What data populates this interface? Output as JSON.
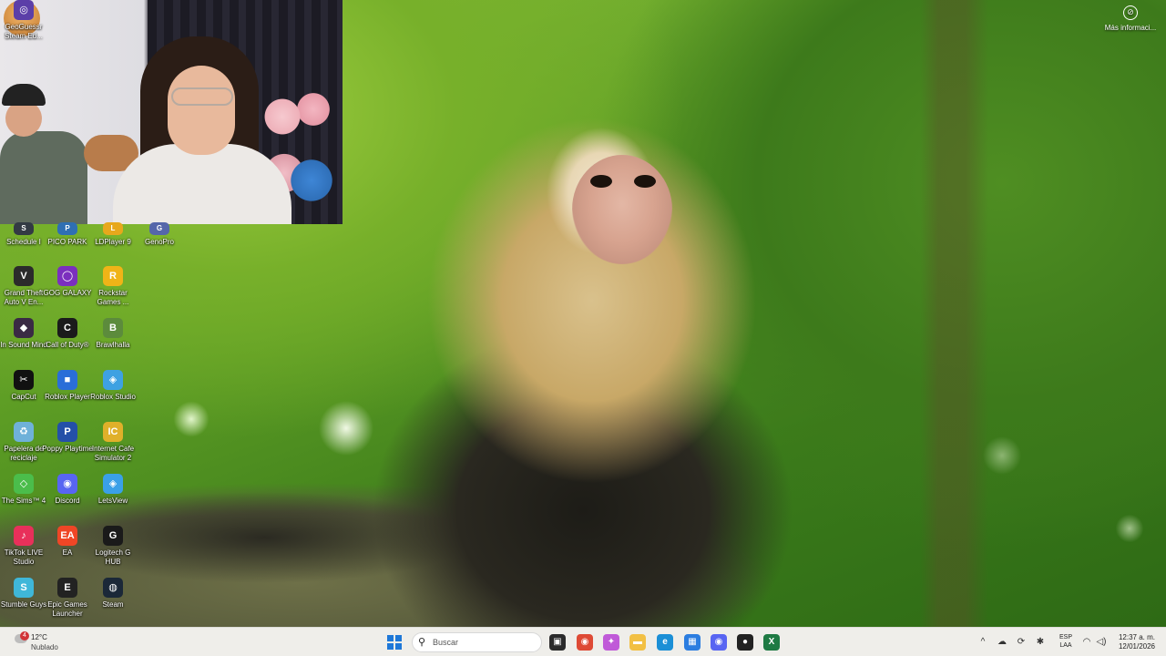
{
  "desktop": {
    "icons": [
      {
        "label": "Schedule I",
        "glyph": "S",
        "color": "#333a44"
      },
      {
        "label": "PICO PARK",
        "glyph": "P",
        "color": "#2f6fb3"
      },
      {
        "label": "LDPlayer 9",
        "glyph": "L",
        "color": "#e7a81c"
      },
      {
        "label": "GenoPro",
        "glyph": "G",
        "color": "#5566aa"
      },
      {
        "label": "Grand Theft Auto V En...",
        "glyph": "V",
        "color": "#2b2b2b"
      },
      {
        "label": "GOG GALAXY",
        "glyph": "◯",
        "color": "#7b2fbe"
      },
      {
        "label": "Rockstar Games ...",
        "glyph": "R",
        "color": "#f0b417"
      },
      {
        "label": "In Sound Mind",
        "glyph": "◆",
        "color": "#3a2a44"
      },
      {
        "label": "Call of Duty®",
        "glyph": "C",
        "color": "#1b1b1b"
      },
      {
        "label": "Brawlhalla",
        "glyph": "B",
        "color": "#5c8b3c"
      },
      {
        "label": "CapCut",
        "glyph": "✂",
        "color": "#111111"
      },
      {
        "label": "Roblox Player",
        "glyph": "■",
        "color": "#2a6ed8"
      },
      {
        "label": "Roblox Studio",
        "glyph": "◈",
        "color": "#3ea1e2"
      },
      {
        "label": "Papelera de reciclaje",
        "glyph": "♻",
        "color": "#6fb1d9"
      },
      {
        "label": "Poppy Playtime",
        "glyph": "P",
        "color": "#2450a8"
      },
      {
        "label": "Internet Cafe Simulator 2",
        "glyph": "IC",
        "color": "#e0b02a"
      },
      {
        "label": "The Sims™ 4",
        "glyph": "◇",
        "color": "#4bbd4b"
      },
      {
        "label": "Discord",
        "glyph": "◉",
        "color": "#5865f2"
      },
      {
        "label": "LetsView",
        "glyph": "◈",
        "color": "#3aa0e8"
      },
      {
        "label": "TikTok LIVE Studio",
        "glyph": "♪",
        "color": "#e8305a"
      },
      {
        "label": "EA",
        "glyph": "EA",
        "color": "#ef4626"
      },
      {
        "label": "Logitech G HUB",
        "glyph": "G",
        "color": "#1a1a1a"
      },
      {
        "label": "Stumble Guys",
        "glyph": "S",
        "color": "#3fb7d9"
      },
      {
        "label": "Epic Games Launcher",
        "glyph": "E",
        "color": "#222222"
      },
      {
        "label": "Steam",
        "glyph": "◍",
        "color": "#1b2838"
      },
      {
        "label": "GeoGuessr Steam Ed...",
        "glyph": "◎",
        "color": "#5c3fa8"
      }
    ]
  },
  "spotlight": {
    "label": "Más informaci...",
    "icon": "info-circle-icon"
  },
  "taskbar": {
    "weather": {
      "temp": "12°C",
      "condition": "Nublado",
      "badge": "4"
    },
    "search_placeholder": "Buscar",
    "apps": [
      {
        "name": "task-view",
        "glyph": "▣",
        "color": "#2b2b2b"
      },
      {
        "name": "chrome",
        "glyph": "◉",
        "color": "#de4a35"
      },
      {
        "name": "copilot",
        "glyph": "✦",
        "color": "#c05ad8"
      },
      {
        "name": "file-explorer",
        "glyph": "▬",
        "color": "#f2c044"
      },
      {
        "name": "edge",
        "glyph": "e",
        "color": "#1b8fd6"
      },
      {
        "name": "microsoft-store",
        "glyph": "▦",
        "color": "#2b7de0"
      },
      {
        "name": "discord",
        "glyph": "◉",
        "color": "#5865f2"
      },
      {
        "name": "roblox",
        "glyph": "●",
        "color": "#222222"
      },
      {
        "name": "excel",
        "glyph": "X",
        "color": "#1e7a43"
      }
    ],
    "tray": {
      "lang_top": "ESP",
      "lang_bottom": "LAA",
      "time": "12:37 a. m.",
      "date": "12/01/2026"
    }
  }
}
